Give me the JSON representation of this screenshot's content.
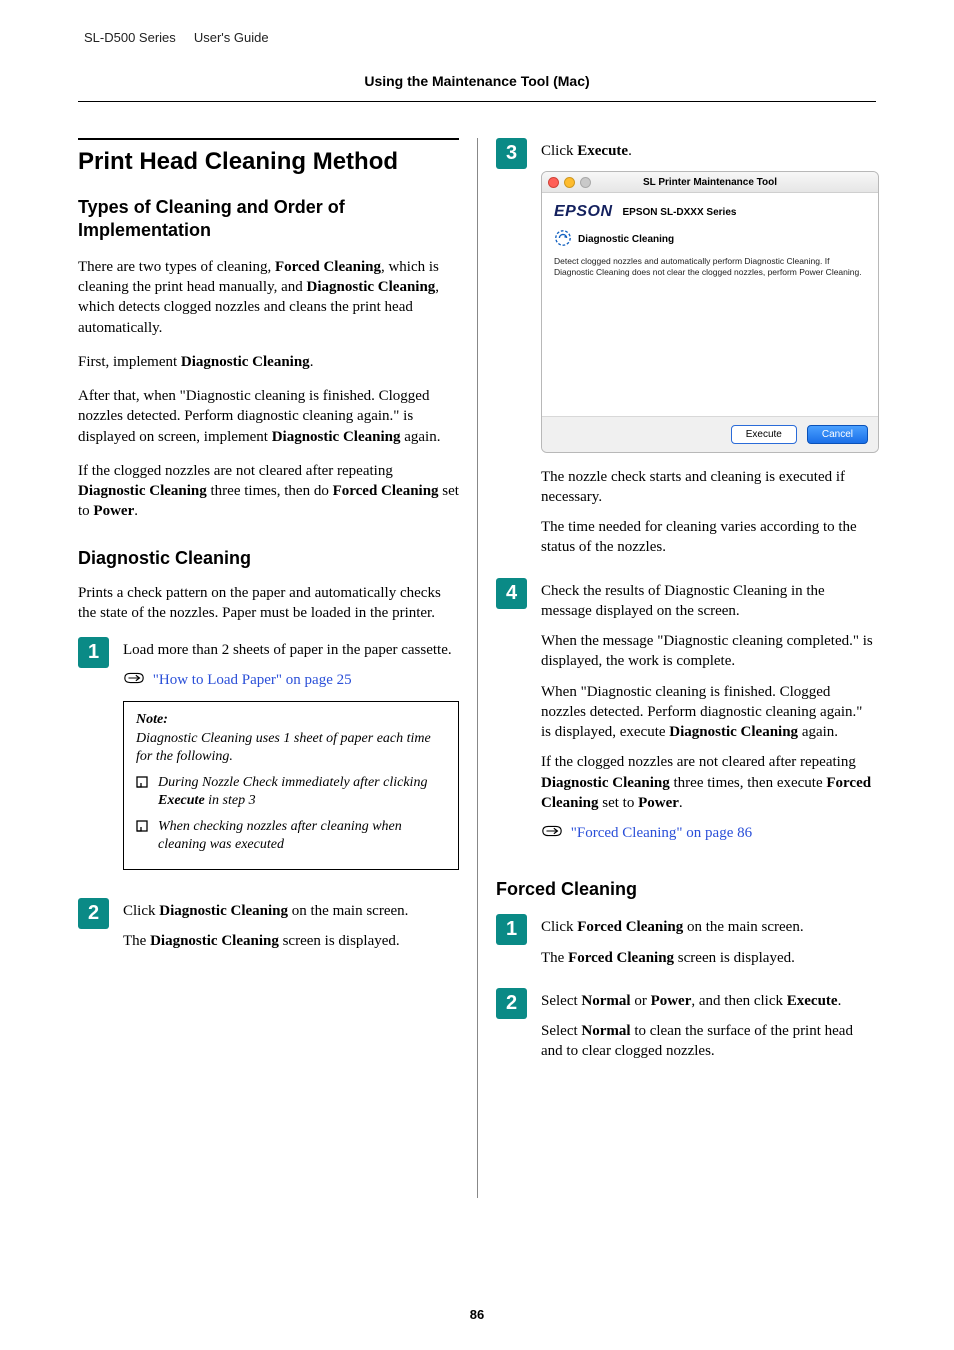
{
  "header": {
    "series": "SL-D500 Series",
    "doc": "User's Guide",
    "section": "Using the Maintenance Tool (Mac)"
  },
  "left": {
    "h1": "Print Head Cleaning Method",
    "h2": "Types of Cleaning and Order of Implementation",
    "p1_a": "There are two types of cleaning, ",
    "p1_b": "Forced Cleaning",
    "p1_c": ", which is cleaning the print head manually, and ",
    "p1_d": "Diagnostic Cleaning",
    "p1_e": ", which detects clogged nozzles and cleans the print head automatically.",
    "p2_a": "First, implement ",
    "p2_b": "Diagnostic Cleaning",
    "p2_c": ".",
    "p3_a": "After that, when \"Diagnostic cleaning is finished. Clogged nozzles detected. Perform diagnostic cleaning again.\" is displayed on screen, implement ",
    "p3_b": "Diagnostic Cleaning",
    "p3_c": " again.",
    "p4_a": "If the clogged nozzles are not cleared after repeating ",
    "p4_b": "Diagnostic Cleaning",
    "p4_c": " three times, then do ",
    "p4_d": "Forced Cleaning",
    "p4_e": " set to ",
    "p4_f": "Power",
    "p4_g": ".",
    "h3_diag": "Diagnostic Cleaning",
    "p5": "Prints a check pattern on the paper and automatically checks the state of the nozzles. Paper must be loaded in the printer.",
    "step1": "Load more than 2 sheets of paper in the paper cassette.",
    "xref1": "\"How to Load Paper\" on page 25",
    "note": {
      "title": "Note:",
      "lead": "Diagnostic Cleaning uses 1 sheet of paper each time for the following.",
      "i1_a": "During Nozzle Check immediately after clicking ",
      "i1_b": "Execute",
      "i1_c": " in step 3",
      "i2": "When checking nozzles after cleaning when cleaning was executed"
    },
    "step2_a": "Click ",
    "step2_b": "Diagnostic Cleaning",
    "step2_c": " on the main screen.",
    "step2_d_a": "The ",
    "step2_d_b": "Diagnostic Cleaning",
    "step2_d_c": " screen is displayed."
  },
  "right": {
    "step3_a": "Click ",
    "step3_b": "Execute",
    "step3_c": ".",
    "window": {
      "title": "SL Printer Maintenance Tool",
      "brand": "EPSON",
      "model": "EPSON SL-DXXX Series",
      "diag_label": "Diagnostic Cleaning",
      "diag_desc": "Detect clogged nozzles and automatically perform Diagnostic Cleaning. If Diagnostic Cleaning does not clear the clogged nozzles, perform Power Cleaning.",
      "execute": "Execute",
      "cancel": "Cancel"
    },
    "p1": "The nozzle check starts and cleaning is executed if necessary.",
    "p2": "The time needed for cleaning varies according to the status of the nozzles.",
    "step4_a": "Check the results of Diagnostic Cleaning in the message displayed on the screen.",
    "p3": "When the message \"Diagnostic cleaning completed.\" is displayed, the work is complete.",
    "p4_a": "When \"Diagnostic cleaning is finished. Clogged nozzles detected. Perform diagnostic cleaning again.\" is displayed, execute ",
    "p4_b": "Diagnostic Cleaning",
    "p4_c": " again.",
    "p5_a": "If the clogged nozzles are not cleared after repeating ",
    "p5_b": "Diagnostic Cleaning",
    "p5_c": " three times, then execute ",
    "p5_d": "Forced Cleaning",
    "p5_e": " set to ",
    "p5_f": "Power",
    "p5_g": ".",
    "xref2": "\"Forced Cleaning\" on page 86",
    "h3_forced": "Forced Cleaning",
    "f_step1_a": "Click ",
    "f_step1_b": "Forced Cleaning",
    "f_step1_c": " on the main screen.",
    "f_step1_d_a": "The ",
    "f_step1_d_b": "Forced Cleaning",
    "f_step1_d_c": " screen is displayed.",
    "f_step2_a": "Select ",
    "f_step2_b": "Normal",
    "f_step2_c": " or ",
    "f_step2_d": "Power",
    "f_step2_e": ", and then click ",
    "f_step2_f": "Execute",
    "f_step2_g": ".",
    "f_step2_p_a": "Select ",
    "f_step2_p_b": "Normal",
    "f_step2_p_c": " to clean the surface of the print head and to clear clogged nozzles."
  },
  "page_number": "86"
}
